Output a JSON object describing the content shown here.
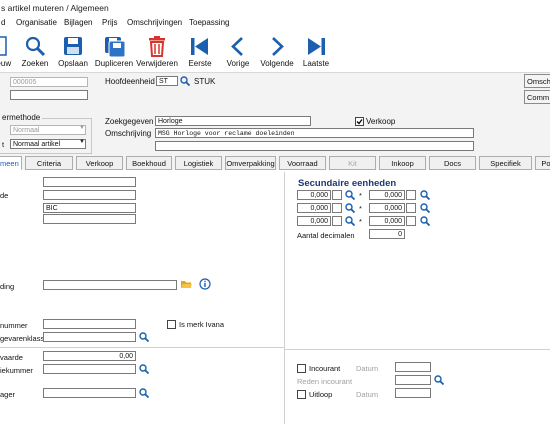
{
  "window": {
    "title": "s artikel muteren / Algemeen"
  },
  "menu": [
    "d",
    "Organisatie",
    "Bijlagen",
    "Prijs",
    "Omschrijvingen",
    "Toepassing"
  ],
  "toolbar": [
    {
      "label": "Nieuw",
      "icon": "new-document-icon"
    },
    {
      "label": "Zoeken",
      "icon": "search-icon"
    },
    {
      "label": "Opslaan",
      "icon": "save-icon"
    },
    {
      "label": "Dupliceren",
      "icon": "duplicate-icon"
    },
    {
      "label": "Verwijderen",
      "icon": "trash-icon"
    },
    {
      "label": "Eerste",
      "icon": "first-icon"
    },
    {
      "label": "Vorige",
      "icon": "previous-icon"
    },
    {
      "label": "Volgende",
      "icon": "next-icon"
    },
    {
      "label": "Laatste",
      "icon": "last-icon"
    }
  ],
  "header": {
    "article_number": "000005",
    "hoofdeenheid_label": "Hoofdeenheid",
    "hoofdeenheid_code": "ST",
    "hoofdeenheid_name": "STUK",
    "group_title": "ermethode",
    "method_value": "Normaal",
    "type_value": "Normaal artikel",
    "type_label": "t",
    "zoekgegeven_label": "Zoekgegeven",
    "zoekgegeven_value": "Horloge",
    "omschrijving_label": "Omschrijving",
    "omschrijving_value": "MSG Horloge voor reclame doeleinden",
    "verkoop_label": "Verkoop",
    "verkoop_checked": true,
    "right_buttons": [
      "Omschri",
      "Comm"
    ]
  },
  "tabs": [
    {
      "label": "Algemeen",
      "state": "active"
    },
    {
      "label": "Criteria",
      "state": "normal"
    },
    {
      "label": "Verkoop",
      "state": "normal"
    },
    {
      "label": "Boekhoud",
      "state": "normal"
    },
    {
      "label": "Logistiek",
      "state": "normal"
    },
    {
      "label": "Omverpakking",
      "state": "normal"
    },
    {
      "label": "Voorraad",
      "state": "normal"
    },
    {
      "label": "Kit",
      "state": "disabled"
    },
    {
      "label": "Inkoop",
      "state": "normal"
    },
    {
      "label": "Docs",
      "state": "normal"
    },
    {
      "label": "Specifiek",
      "state": "normal"
    },
    {
      "label": "Po",
      "state": "normal"
    }
  ],
  "left": {
    "field3_value": "BIC",
    "label_de": "de",
    "label_ding": "ding",
    "label_nummer": "nummer",
    "label_gevarenklasse": "gevarenklasse",
    "merk_label": "Is merk Ivana",
    "label_waarde": "vaarde",
    "waarde_value": "0,00",
    "label_iekummer": "iekummer",
    "label_ager": "ager"
  },
  "secundaire": {
    "title": "Secundaire eenheden",
    "rows": [
      {
        "a": "0,000",
        "b": "0,000"
      },
      {
        "a": "0,000",
        "b": "0,000"
      },
      {
        "a": "0,000",
        "b": "0,000"
      }
    ],
    "times": "*",
    "decimalen_label": "Aantal decimalen",
    "decimalen_value": "0"
  },
  "status": {
    "incourant_label": "Incourant",
    "datum_label": "Datum",
    "reden_label": "Reden incourant",
    "uitloop_label": "Uitloop"
  },
  "colors": {
    "accent": "#1f5fbf",
    "icon_blue": "#1b5fae",
    "delete_red": "#d9342b",
    "heading": "#1c3a70"
  }
}
